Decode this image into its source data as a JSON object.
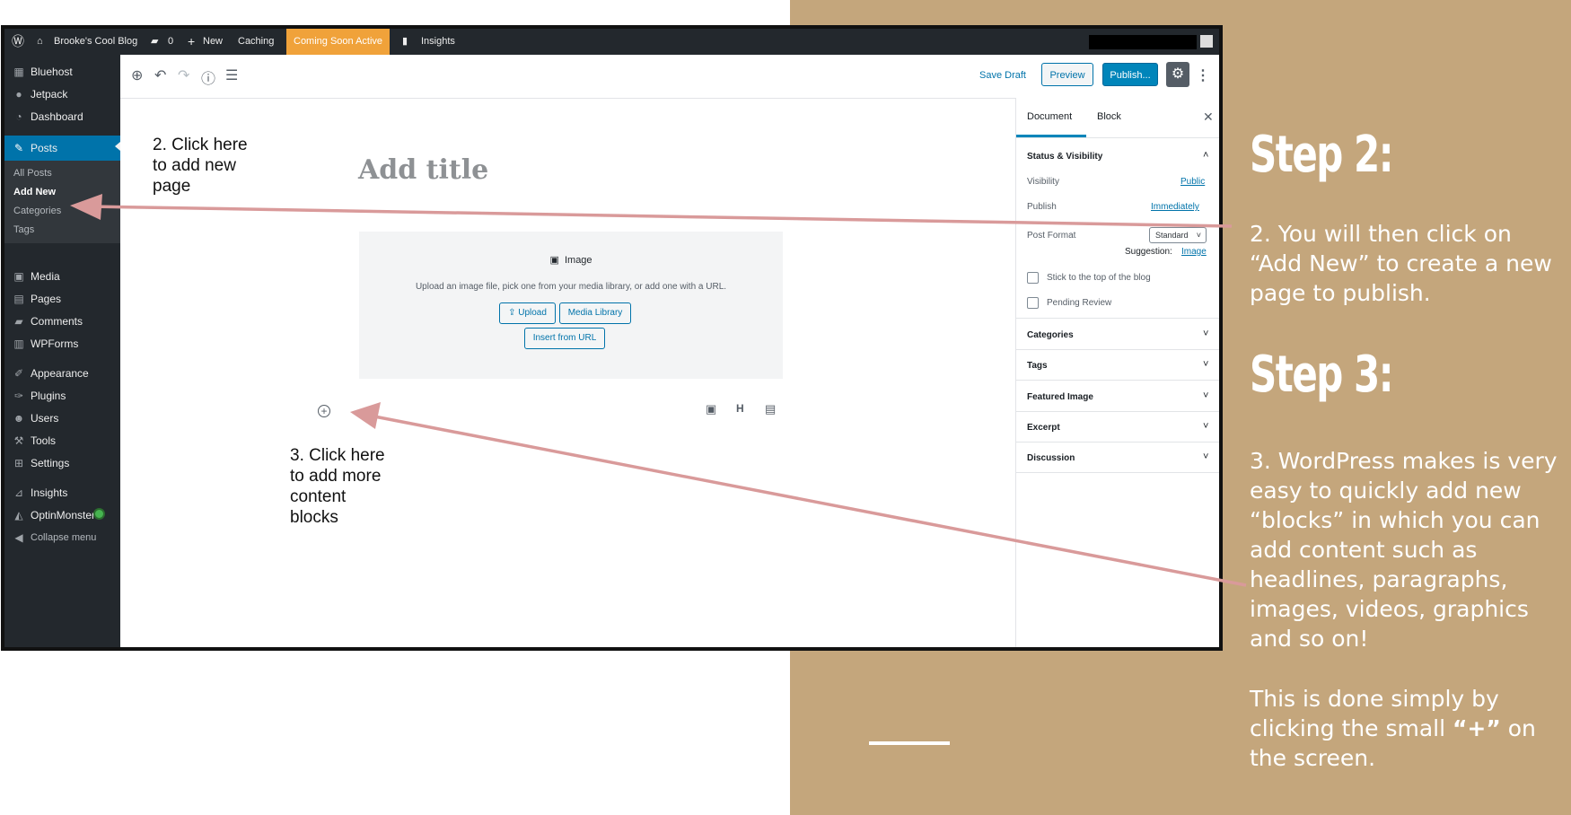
{
  "admin_bar": {
    "site_name": "Brooke's Cool Blog",
    "comments_count": "0",
    "new_label": "New",
    "caching_label": "Caching",
    "coming_soon_label": "Coming Soon Active",
    "insights_label": "Insights"
  },
  "sidebar": {
    "items": [
      {
        "label": "Bluehost",
        "icon": "grid-icon"
      },
      {
        "label": "Jetpack",
        "icon": "jetpack-icon"
      },
      {
        "label": "Dashboard",
        "icon": "dashboard-icon"
      },
      {
        "label": "Posts",
        "icon": "pin-icon"
      },
      {
        "label": "Media",
        "icon": "media-icon"
      },
      {
        "label": "Pages",
        "icon": "pages-icon"
      },
      {
        "label": "Comments",
        "icon": "comments-icon"
      },
      {
        "label": "WPForms",
        "icon": "forms-icon"
      },
      {
        "label": "Appearance",
        "icon": "brush-icon"
      },
      {
        "label": "Plugins",
        "icon": "plugin-icon"
      },
      {
        "label": "Users",
        "icon": "users-icon"
      },
      {
        "label": "Tools",
        "icon": "wrench-icon"
      },
      {
        "label": "Settings",
        "icon": "settings-icon"
      },
      {
        "label": "Insights",
        "icon": "insights-icon"
      },
      {
        "label": "OptinMonster",
        "icon": "monster-icon"
      },
      {
        "label": "Collapse menu",
        "icon": "collapse-icon"
      }
    ],
    "posts_submenu": [
      "All Posts",
      "Add New",
      "Categories",
      "Tags"
    ]
  },
  "toolbar": {
    "save_draft": "Save Draft",
    "preview": "Preview",
    "publish": "Publish..."
  },
  "editor": {
    "title_placeholder": "Add title",
    "image_block": {
      "heading": "Image",
      "description": "Upload an image file, pick one from your media library, or add one with a URL.",
      "upload": "Upload",
      "media_library": "Media Library",
      "insert_url": "Insert from URL"
    }
  },
  "settings_panel": {
    "tabs": [
      "Document",
      "Block"
    ],
    "status_title": "Status & Visibility",
    "visibility_label": "Visibility",
    "visibility_value": "Public",
    "publish_label": "Publish",
    "publish_value": "Immediately",
    "post_format_label": "Post Format",
    "post_format_value": "Standard",
    "suggestion_label": "Suggestion:",
    "suggestion_value": "Image",
    "stick_label": "Stick to the top of the blog",
    "pending_label": "Pending Review",
    "sections": [
      "Categories",
      "Tags",
      "Featured Image",
      "Excerpt",
      "Discussion"
    ]
  },
  "annotations": {
    "note_2": "2. Click here\nto add new\npage",
    "note_3": "3. Click here\nto add more\ncontent\nblocks"
  },
  "right_panel": {
    "step2_heading": "Step 2:",
    "step2_text": "2. You will then click on “Add New” to create a new page to publish.",
    "step3_heading": "Step 3:",
    "step3_text": "3. WordPress makes is very easy to quickly add new “blocks” in which you can add content such as headlines, paragraphs, images, videos, graphics and so on!",
    "step3_text2_pre": "This is done simply by clicking the small ",
    "step3_text2_bold": "“+”",
    "step3_text2_post": " on the screen."
  },
  "colors": {
    "panel_tan": "#c4a67c",
    "arrow_pink": "#d99a9a",
    "wp_blue": "#0085ba",
    "admin_dark": "#23282d",
    "coming_soon_orange": "#f0a23a"
  }
}
